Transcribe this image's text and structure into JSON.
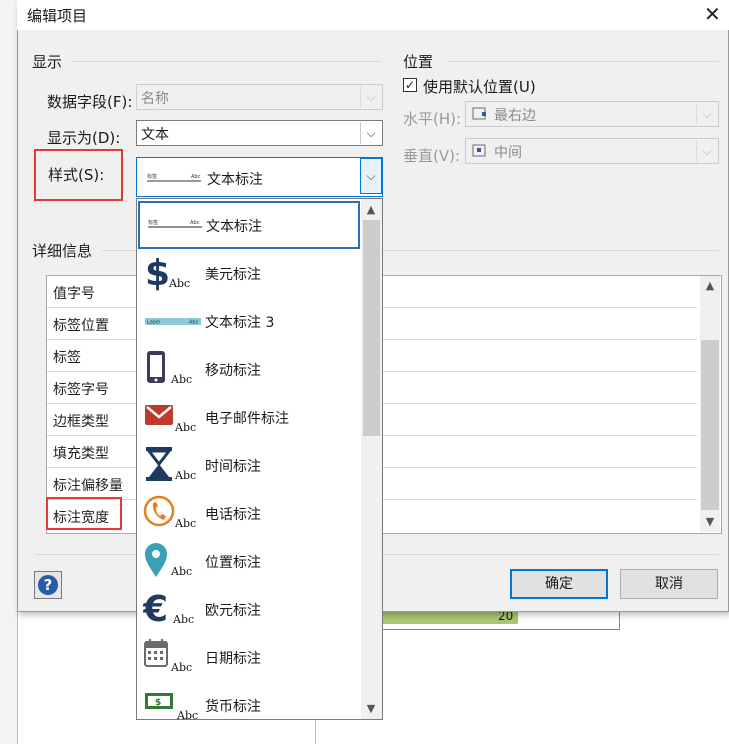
{
  "dialog": {
    "title": "编辑项目",
    "close_glyph": "✕",
    "display_group": "显示",
    "position_group": "位置",
    "details_group": "详细信息"
  },
  "display": {
    "data_field_label": "数据字段(F):",
    "data_field_value": "名称",
    "display_as_label": "显示为(D):",
    "display_as_value": "文本",
    "style_label": "样式(S):",
    "style_value": "文本标注"
  },
  "position": {
    "use_default_label": "使用默认位置(U)",
    "use_default_checked": true,
    "horizontal_label": "水平(H):",
    "horizontal_value": "最右边",
    "vertical_label": "垂直(V):",
    "vertical_value": "中间"
  },
  "details": {
    "rows": [
      "值字号",
      "标签位置",
      "标签",
      "标签字号",
      "边框类型",
      "填充类型",
      "标注偏移量",
      "标注宽度"
    ]
  },
  "buttons": {
    "ok": "确定",
    "cancel": "取消",
    "help": "?"
  },
  "style_dropdown": {
    "items": [
      {
        "label": "文本标注",
        "icon": "text-callout-icon"
      },
      {
        "label": "美元标注",
        "icon": "dollar-icon"
      },
      {
        "label": "文本标注 3",
        "icon": "text-callout-3-icon"
      },
      {
        "label": "移动标注",
        "icon": "mobile-phone-icon"
      },
      {
        "label": "电子邮件标注",
        "icon": "envelope-icon"
      },
      {
        "label": "时间标注",
        "icon": "hourglass-icon"
      },
      {
        "label": "电话标注",
        "icon": "phone-icon"
      },
      {
        "label": "位置标注",
        "icon": "map-pin-icon"
      },
      {
        "label": "欧元标注",
        "icon": "euro-icon"
      },
      {
        "label": "日期标注",
        "icon": "calendar-icon"
      },
      {
        "label": "货币标注",
        "icon": "banknote-icon"
      }
    ],
    "icon_caption": "Abc"
  },
  "background": {
    "bar_value": "20"
  },
  "colors": {
    "accent": "#0078d7",
    "highlight_red": "#e53935",
    "icon_dark": "#1f3a5f",
    "icon_teal": "#3aa0b5",
    "icon_red": "#c0392b",
    "icon_orange": "#e67e22",
    "bar_green": "#a9c575"
  }
}
